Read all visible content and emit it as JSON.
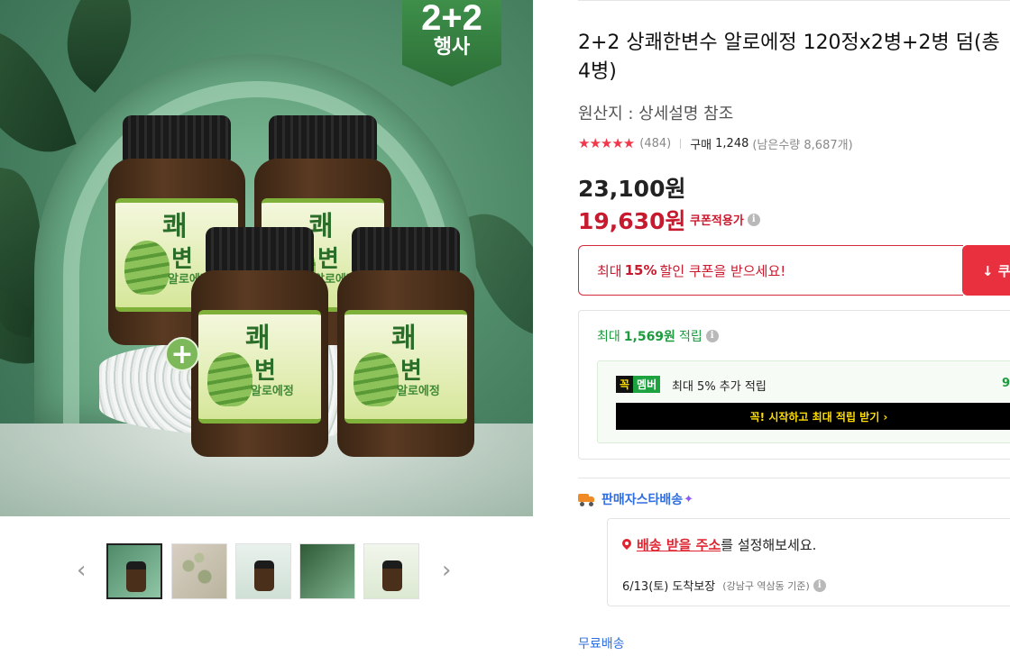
{
  "hero": {
    "badge_top": "2+2",
    "badge_bottom": "행사",
    "jar_title_1": "쾌",
    "jar_title_2": "변",
    "jar_sub": "알로에정",
    "jar_logo": "ऌ",
    "plus_glyph": "+"
  },
  "gallery": {
    "prev_glyph": "‹",
    "next_glyph": "›"
  },
  "product": {
    "title": "2+2 상쾌한변수 알로에정 120정x2병+2병 덤(총4병)",
    "origin": "원산지 : 상세설명 참조",
    "rating_stars": "★★★★★",
    "review_count": "(484)",
    "buy_label": "구매",
    "buy_count": "1,248",
    "stock": "(남은수량 8,687개)",
    "price_original": "23,100원",
    "price_sale": "19,630원",
    "coupon_applied": "쿠폰적용가"
  },
  "coupon": {
    "prefix": "최대",
    "percent": "15%",
    "suffix": "할인 쿠폰을 받으세요!",
    "button_label": "↓ 쿠"
  },
  "reward": {
    "prefix": "최대",
    "amount": "1,569원",
    "suffix": "적립",
    "member_k": "꼭",
    "member_m": "멤버",
    "member_text": "최대 5% 추가 적립",
    "member_amount": "9",
    "member_cta": "꼭! 시작하고 최대 적립 받기 ›"
  },
  "shipping": {
    "seller_star": "판매자스타배송",
    "sparkle": "✦",
    "address_link": "배송 받을 주소",
    "address_suffix": "를 설정해보세요.",
    "arrive": "6/13(토) 도착보장",
    "arrive_note": "(강남구 역삼동 기준)",
    "free_shipping": "무료배송"
  },
  "colors": {
    "sale_red": "#c81a2f",
    "reward_green": "#1c9b3e",
    "link_blue": "#2f6ee0"
  }
}
